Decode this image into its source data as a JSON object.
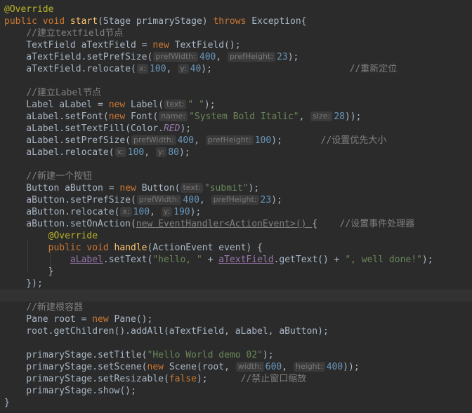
{
  "code_lines": [
    [
      {
        "t": "@Override",
        "c": "ann"
      }
    ],
    [
      {
        "t": "public void ",
        "c": "kw"
      },
      {
        "t": "start",
        "c": "fn"
      },
      {
        "t": "(Stage primaryStage) "
      },
      {
        "t": "throws ",
        "c": "kw"
      },
      {
        "t": "Exception{"
      }
    ],
    [
      {
        "t": "    "
      },
      {
        "t": "//建立textfield节点",
        "c": "cmt"
      }
    ],
    [
      {
        "t": "    TextField aTextField = "
      },
      {
        "t": "new ",
        "c": "kw"
      },
      {
        "t": "TextField();"
      }
    ],
    [
      {
        "t": "    aTextField.setPrefSize("
      },
      {
        "h": "prefWidth:"
      },
      {
        "t": "400",
        "c": "num"
      },
      {
        "t": ", "
      },
      {
        "h": "prefHeight:"
      },
      {
        "t": "23",
        "c": "num"
      },
      {
        "t": ");"
      }
    ],
    [
      {
        "t": "    aTextField.relocate("
      },
      {
        "h": "x:"
      },
      {
        "t": "100",
        "c": "num"
      },
      {
        "t": ", "
      },
      {
        "h": "y:"
      },
      {
        "t": "40",
        "c": "num"
      },
      {
        "t": ");                         "
      },
      {
        "t": "//重新定位",
        "c": "cmt"
      }
    ],
    [
      {
        "t": ""
      }
    ],
    [
      {
        "t": "    "
      },
      {
        "t": "//建立Label节点",
        "c": "cmt"
      }
    ],
    [
      {
        "t": "    Label aLabel = "
      },
      {
        "t": "new ",
        "c": "kw"
      },
      {
        "t": "Label("
      },
      {
        "h": "text:"
      },
      {
        "t": "\" \"",
        "c": "str"
      },
      {
        "t": ");"
      }
    ],
    [
      {
        "t": "    aLabel.setFont("
      },
      {
        "t": "new ",
        "c": "kw"
      },
      {
        "t": "Font("
      },
      {
        "h": "name:"
      },
      {
        "t": "\"System Bold Italic\"",
        "c": "str"
      },
      {
        "t": ", "
      },
      {
        "h": "size:"
      },
      {
        "t": "28",
        "c": "num"
      },
      {
        "t": "));"
      }
    ],
    [
      {
        "t": "    aLabel.setTextFill(Color."
      },
      {
        "t": "RED",
        "c": "const"
      },
      {
        "t": ");"
      }
    ],
    [
      {
        "t": "    aLabel.setPrefSize("
      },
      {
        "h": "prefWidth:"
      },
      {
        "t": "400",
        "c": "num"
      },
      {
        "t": ", "
      },
      {
        "h": "prefHeight:"
      },
      {
        "t": "100",
        "c": "num"
      },
      {
        "t": ");       "
      },
      {
        "t": "//设置优先大小",
        "c": "cmt"
      }
    ],
    [
      {
        "t": "    aLabel.relocate("
      },
      {
        "h": "x:"
      },
      {
        "t": "100",
        "c": "num"
      },
      {
        "t": ", "
      },
      {
        "h": "y:"
      },
      {
        "t": "80",
        "c": "num"
      },
      {
        "t": ");"
      }
    ],
    [
      {
        "t": ""
      }
    ],
    [
      {
        "t": "    "
      },
      {
        "t": "//新建一个按钮",
        "c": "cmt"
      }
    ],
    [
      {
        "t": "    Button aButton = "
      },
      {
        "t": "new ",
        "c": "kw"
      },
      {
        "t": "Button("
      },
      {
        "h": "text:"
      },
      {
        "t": "\"submit\"",
        "c": "str"
      },
      {
        "t": ");"
      }
    ],
    [
      {
        "t": "    aButton.setPrefSize("
      },
      {
        "h": "prefWidth:"
      },
      {
        "t": "400",
        "c": "num"
      },
      {
        "t": ", "
      },
      {
        "h": "prefHeight:"
      },
      {
        "t": "23",
        "c": "num"
      },
      {
        "t": ");"
      }
    ],
    [
      {
        "t": "    aButton.relocate("
      },
      {
        "h": "x:"
      },
      {
        "t": "100",
        "c": "num"
      },
      {
        "t": ", "
      },
      {
        "h": "y:"
      },
      {
        "t": "190",
        "c": "num"
      },
      {
        "t": ");"
      }
    ],
    [
      {
        "t": "    aButton.setOnAction("
      },
      {
        "t": "new EventHandler<ActionEvent>() ",
        "c": "anon"
      },
      {
        "t": "{    "
      },
      {
        "t": "//设置事件处理器",
        "c": "cmt"
      }
    ],
    [
      {
        "t": "        "
      },
      {
        "t": "@Override",
        "c": "ann"
      }
    ],
    [
      {
        "t": "        "
      },
      {
        "t": "public void ",
        "c": "kw"
      },
      {
        "t": "handle",
        "c": "fn"
      },
      {
        "t": "(ActionEvent event) {"
      }
    ],
    [
      {
        "t": "            "
      },
      {
        "t": "aLabel",
        "c": "field"
      },
      {
        "t": ".setText("
      },
      {
        "t": "\"hello, \"",
        "c": "str"
      },
      {
        "t": " + "
      },
      {
        "t": "aTextField",
        "c": "field"
      },
      {
        "t": ".getText() + "
      },
      {
        "t": "\", well done!\"",
        "c": "str"
      },
      {
        "t": ");"
      }
    ],
    [
      {
        "t": "        }"
      }
    ],
    [
      {
        "t": "    });"
      }
    ],
    [
      {
        "t": ""
      }
    ],
    [
      {
        "t": "    "
      },
      {
        "t": "//新建根容器",
        "c": "cmt"
      }
    ],
    [
      {
        "t": "    Pane root = "
      },
      {
        "t": "new ",
        "c": "kw"
      },
      {
        "t": "Pane();"
      }
    ],
    [
      {
        "t": "    root.getChildren().addAll(aTextField, aLabel, aButton);"
      }
    ],
    [
      {
        "t": ""
      }
    ],
    [
      {
        "t": "    primaryStage.setTitle("
      },
      {
        "t": "\"Hello World demo 02\"",
        "c": "str"
      },
      {
        "t": ");"
      }
    ],
    [
      {
        "t": "    primaryStage.setScene("
      },
      {
        "t": "new ",
        "c": "kw"
      },
      {
        "t": "Scene(root, "
      },
      {
        "h": "width:"
      },
      {
        "t": "600",
        "c": "num"
      },
      {
        "t": ", "
      },
      {
        "h": "height:"
      },
      {
        "t": "400",
        "c": "num"
      },
      {
        "t": "));"
      }
    ],
    [
      {
        "t": "    primaryStage.setResizable("
      },
      {
        "t": "false",
        "c": "kw"
      },
      {
        "t": ");      "
      },
      {
        "t": "//禁止窗口缩放",
        "c": "cmt"
      }
    ],
    [
      {
        "t": "    primaryStage.show();"
      }
    ],
    [
      {
        "t": "}"
      }
    ]
  ],
  "current_line_index": 24,
  "colors": {
    "background": "#2b2b2b",
    "text": "#a9b7c6",
    "keyword": "#cc7832",
    "annotation": "#bbb529",
    "method_declaration": "#ffc66d",
    "string": "#6a8759",
    "number": "#6897bb",
    "comment": "#808080",
    "constant": "#9876aa",
    "current_line": "#323232"
  }
}
